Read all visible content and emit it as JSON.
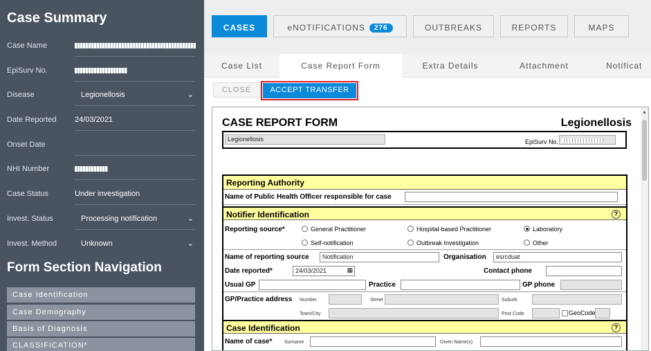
{
  "sidebar": {
    "title": "Case Summary",
    "fields": {
      "case_name": {
        "label": "Case Name",
        "value": ""
      },
      "episurv_no": {
        "label": "EpiSurv No.",
        "value": ""
      },
      "disease": {
        "label": "Disease",
        "value": "Legionellosis"
      },
      "date_reported": {
        "label": "Date Reported",
        "value": "24/03/2021"
      },
      "onset_date": {
        "label": "Onset Date",
        "value": ""
      },
      "nhi_number": {
        "label": "NHI Number",
        "value": ""
      },
      "case_status": {
        "label": "Case Status",
        "value": "Under investigation"
      },
      "invest_status": {
        "label": "Invest. Status",
        "value": "Processing notification"
      },
      "invest_method": {
        "label": "Invest. Method",
        "value": "Unknown"
      }
    },
    "nav_title": "Form Section Navigation",
    "nav_items": [
      "Case Identification",
      "Case Demography",
      "Basis of Diagnosis",
      "CLASSIFICATION*"
    ]
  },
  "topnav": {
    "cases": "CASES",
    "enotifications": "eNOTIFICATIONS",
    "enotifications_count": "276",
    "outbreaks": "OUTBREAKS",
    "reports": "REPORTS",
    "maps": "MAPS"
  },
  "tabs": [
    "Case List",
    "Case Report Form",
    "Extra Details",
    "Attachment",
    "Notificat"
  ],
  "actions": {
    "close": "CLOSE",
    "accept_transfer": "ACCEPT TRANSFER"
  },
  "form": {
    "title": "CASE REPORT FORM",
    "disease_title": "Legionellosis",
    "disease_field": "Legionellosis",
    "episurv_label": "EpiSurv No.",
    "sections": {
      "reporting_authority": {
        "title": "Reporting Authority",
        "officer_label": "Name of Public Health Officer responsible for case"
      },
      "notifier": {
        "title": "Notifier Identification",
        "help": "?",
        "reporting_source_label": "Reporting source*",
        "options": [
          "General Practitioner",
          "Hospital-based Practitioner",
          "Laboratory",
          "Self-notification",
          "Outbreak Investigation",
          "Other"
        ],
        "name_label": "Name of reporting source",
        "name_value": "Notification",
        "org_label": "Organisation",
        "org_value": "esrcduat",
        "date_label": "Date reported*",
        "date_value": "24/03/2021",
        "contact_label": "Contact phone",
        "usual_gp_label": "Usual GP",
        "practice_label": "Practice",
        "gp_phone_label": "GP phone",
        "gp_address_label": "GP/Practice address",
        "number_label": "Number",
        "street_label": "Street",
        "suburb_label": "Suburb",
        "town_label": "Town/City",
        "postcode_label": "Post Code",
        "geocode_label": "GeoCode"
      },
      "case_identification": {
        "title": "Case Identification",
        "help": "?",
        "name_label": "Name of case*",
        "surname_label": "Surname",
        "given_label": "Given Name(s)"
      }
    }
  }
}
